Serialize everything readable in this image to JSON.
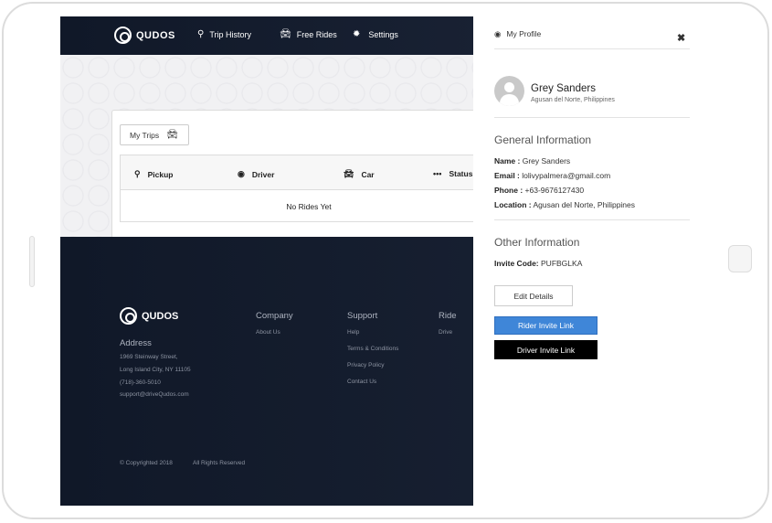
{
  "nav": {
    "logo": "QUDOS",
    "items": [
      {
        "label": "Trip History",
        "icon": "map-pin-icon"
      },
      {
        "label": "Free Rides",
        "icon": "car-icon"
      },
      {
        "label": "Settings",
        "icon": "gear-icon"
      }
    ]
  },
  "trips": {
    "button_label": "My Trips",
    "columns": [
      {
        "label": "Pickup",
        "icon": "map-pin-icon"
      },
      {
        "label": "Driver",
        "icon": "user-circle-icon"
      },
      {
        "label": "Car",
        "icon": "car-icon"
      },
      {
        "label": "Status",
        "icon": "ellipsis-icon"
      }
    ],
    "empty_message": "No Rides Yet"
  },
  "footer": {
    "logo": "QUDOS",
    "address_heading": "Address",
    "address_lines": [
      "1969 Steinway Street,",
      "Long Island City, NY 11105",
      "(718)-360-5010",
      "support@driveQudos.com"
    ],
    "company": {
      "heading": "Company",
      "links": [
        "About Us"
      ]
    },
    "support": {
      "heading": "Support",
      "links": [
        "Help",
        "Terms & Conditions",
        "Privacy Policy",
        "Contact Us"
      ]
    },
    "ride": {
      "heading": "Ride",
      "links": [
        "Drive"
      ]
    },
    "copyright": "© Copyrighted 2018",
    "rights": "All Rights Reserved"
  },
  "profile": {
    "header": "My Profile",
    "close_icon": "close-icon",
    "name": "Grey Sanders",
    "location": "Agusan del Norte, Philippines",
    "general_title": "General Information",
    "fields": [
      {
        "label": "Name :",
        "value": " Grey Sanders"
      },
      {
        "label": "Email :",
        "value": " lolivypalmera@gmail.com"
      },
      {
        "label": "Phone :",
        "value": " +63-9676127430"
      },
      {
        "label": "Location :",
        "value": " Agusan del Norte, Philippines"
      }
    ],
    "other_title": "Other Information",
    "invite_label": "Invite Code:",
    "invite_value": " PUFBGLKA",
    "edit_button": "Edit Details",
    "rider_button": "Rider Invite Link",
    "driver_button": "Driver Invite Link",
    "colors": {
      "rider_button": "#3f86d8",
      "driver_button": "#000000"
    }
  }
}
